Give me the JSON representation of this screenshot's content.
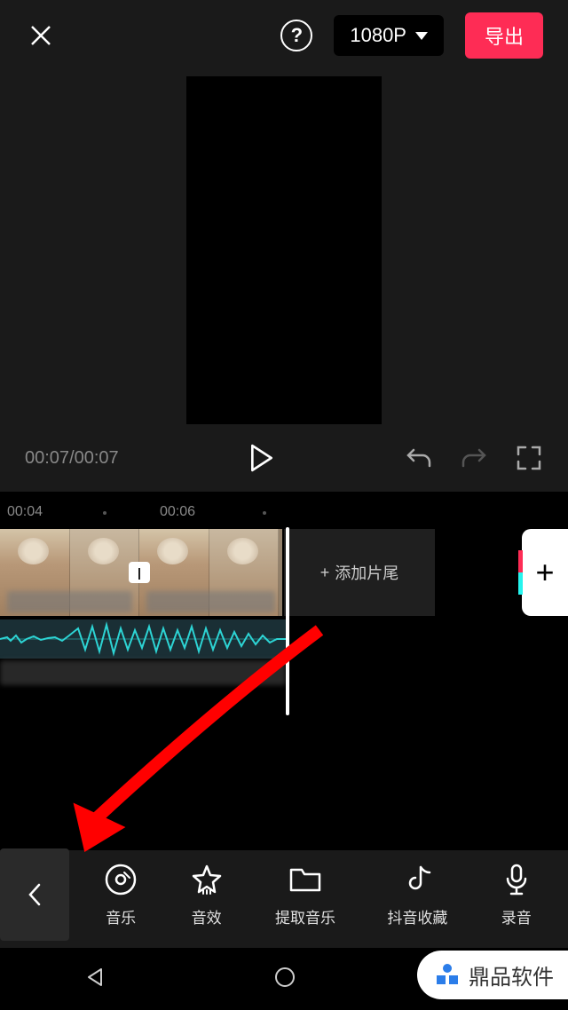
{
  "header": {
    "resolution_label": "1080P",
    "export_label": "导出"
  },
  "playback": {
    "current_time": "00:07",
    "total_time": "00:07"
  },
  "timeline": {
    "marks": [
      "00:04",
      "00:06"
    ],
    "add_ending_label": "添加片尾"
  },
  "toolbar": {
    "items": [
      {
        "label": "音乐",
        "icon": "music-cd-icon"
      },
      {
        "label": "音效",
        "icon": "star-icon"
      },
      {
        "label": "提取音乐",
        "icon": "folder-icon"
      },
      {
        "label": "抖音收藏",
        "icon": "douyin-icon"
      },
      {
        "label": "录音",
        "icon": "microphone-icon"
      }
    ]
  },
  "watermark": {
    "text": "鼎品软件"
  }
}
